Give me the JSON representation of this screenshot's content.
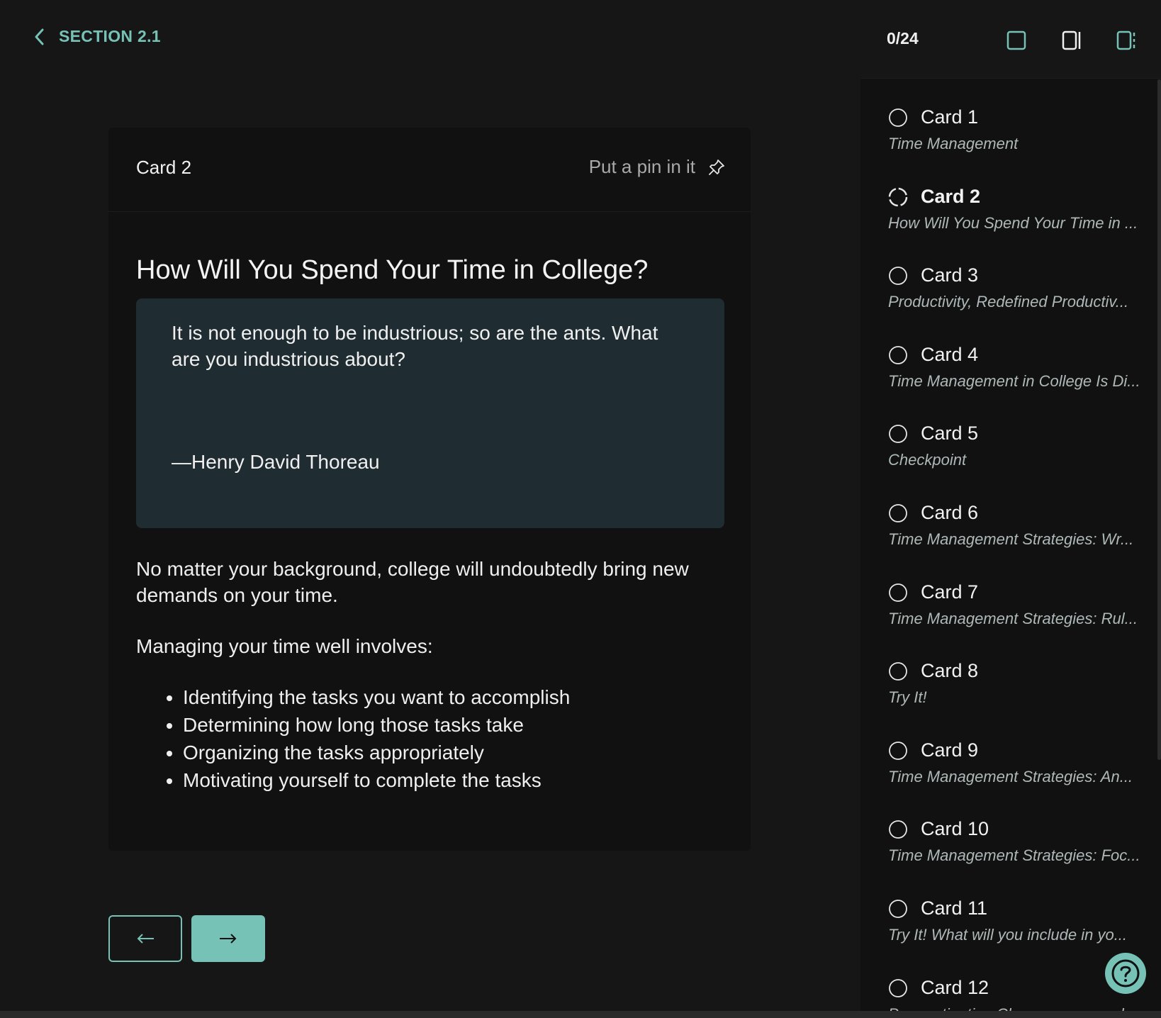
{
  "header": {
    "back_label": "SECTION 2.1"
  },
  "card": {
    "label": "Card 2",
    "pin_label": "Put a pin in it",
    "title": "How Will You Spend Your Time in College?",
    "quote": {
      "text": "It is not enough to be industrious; so are the ants. What are you industrious about?",
      "author": "—Henry David Thoreau"
    },
    "paragraph1": "No matter your background, college will undoubtedly bring new demands on your time.",
    "paragraph2": "Managing your time well involves:",
    "bullets": [
      "Identifying the tasks you want to accomplish",
      "Determining how long those tasks take",
      "Organizing the tasks appropriately",
      "Motivating yourself to complete the tasks"
    ]
  },
  "sidebar": {
    "progress": "0/24",
    "cards": [
      {
        "label": "Card 1",
        "subtitle": "Time Management",
        "current": false
      },
      {
        "label": "Card 2",
        "subtitle": "How Will You Spend Your Time in ...",
        "current": true
      },
      {
        "label": "Card 3",
        "subtitle": "Productivity, Redefined Productiv...",
        "current": false
      },
      {
        "label": "Card 4",
        "subtitle": "Time Management in College Is Di...",
        "current": false
      },
      {
        "label": "Card 5",
        "subtitle": "Checkpoint",
        "current": false
      },
      {
        "label": "Card 6",
        "subtitle": "Time Management Strategies: Wr...",
        "current": false
      },
      {
        "label": "Card 7",
        "subtitle": "Time Management Strategies: Rul...",
        "current": false
      },
      {
        "label": "Card 8",
        "subtitle": "Try It!",
        "current": false
      },
      {
        "label": "Card 9",
        "subtitle": "Time Management Strategies: An...",
        "current": false
      },
      {
        "label": "Card 10",
        "subtitle": "Time Management Strategies: Foc...",
        "current": false
      },
      {
        "label": "Card 11",
        "subtitle": "Try It! What will you include in yo...",
        "current": false
      },
      {
        "label": "Card 12",
        "subtitle": "Procrastination Chances are good...",
        "current": false
      }
    ]
  },
  "colors": {
    "accent": "#76c2b7",
    "quote_bg": "#1f2c32"
  },
  "icons": {
    "back": "chevron-left-icon",
    "pin": "pushpin-icon",
    "prev": "arrow-left-icon",
    "next": "arrow-right-icon",
    "help": "question-icon"
  }
}
